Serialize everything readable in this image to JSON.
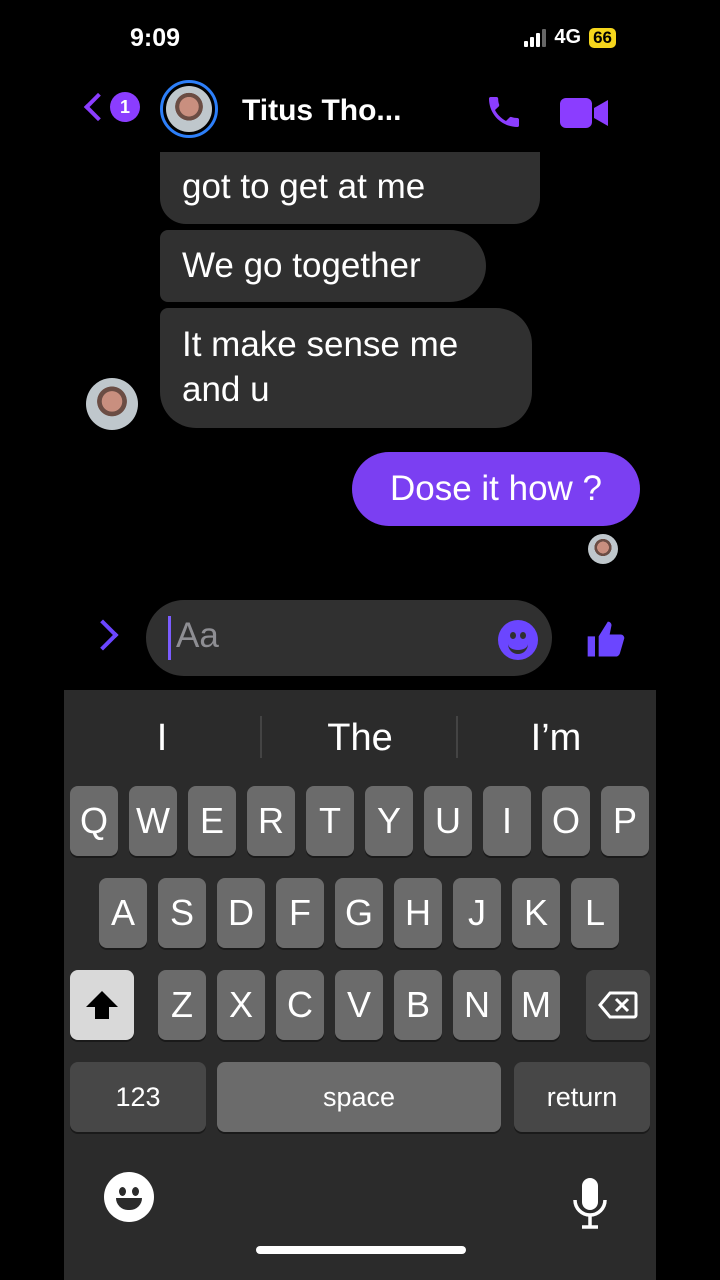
{
  "status": {
    "time": "9:09",
    "network": "4G",
    "battery": "66"
  },
  "header": {
    "back_badge": "1",
    "contact_name": "Titus Tho..."
  },
  "messages": {
    "incoming": [
      "got to get at me",
      "We go together",
      "It make sense me and u"
    ],
    "outgoing": "Dose it how ?"
  },
  "composer": {
    "placeholder": "Aa"
  },
  "keyboard": {
    "suggestions": [
      "I",
      "The",
      "I’m"
    ],
    "row1": [
      "Q",
      "W",
      "E",
      "R",
      "T",
      "Y",
      "U",
      "I",
      "O",
      "P"
    ],
    "row2": [
      "A",
      "S",
      "D",
      "F",
      "G",
      "H",
      "J",
      "K",
      "L"
    ],
    "row3": [
      "Z",
      "X",
      "C",
      "V",
      "B",
      "N",
      "M"
    ],
    "numbers_label": "123",
    "space_label": "space",
    "return_label": "return"
  },
  "colors": {
    "accent": "#7b3ff2",
    "bubble_in": "#303030",
    "battery": "#f5d61c"
  }
}
